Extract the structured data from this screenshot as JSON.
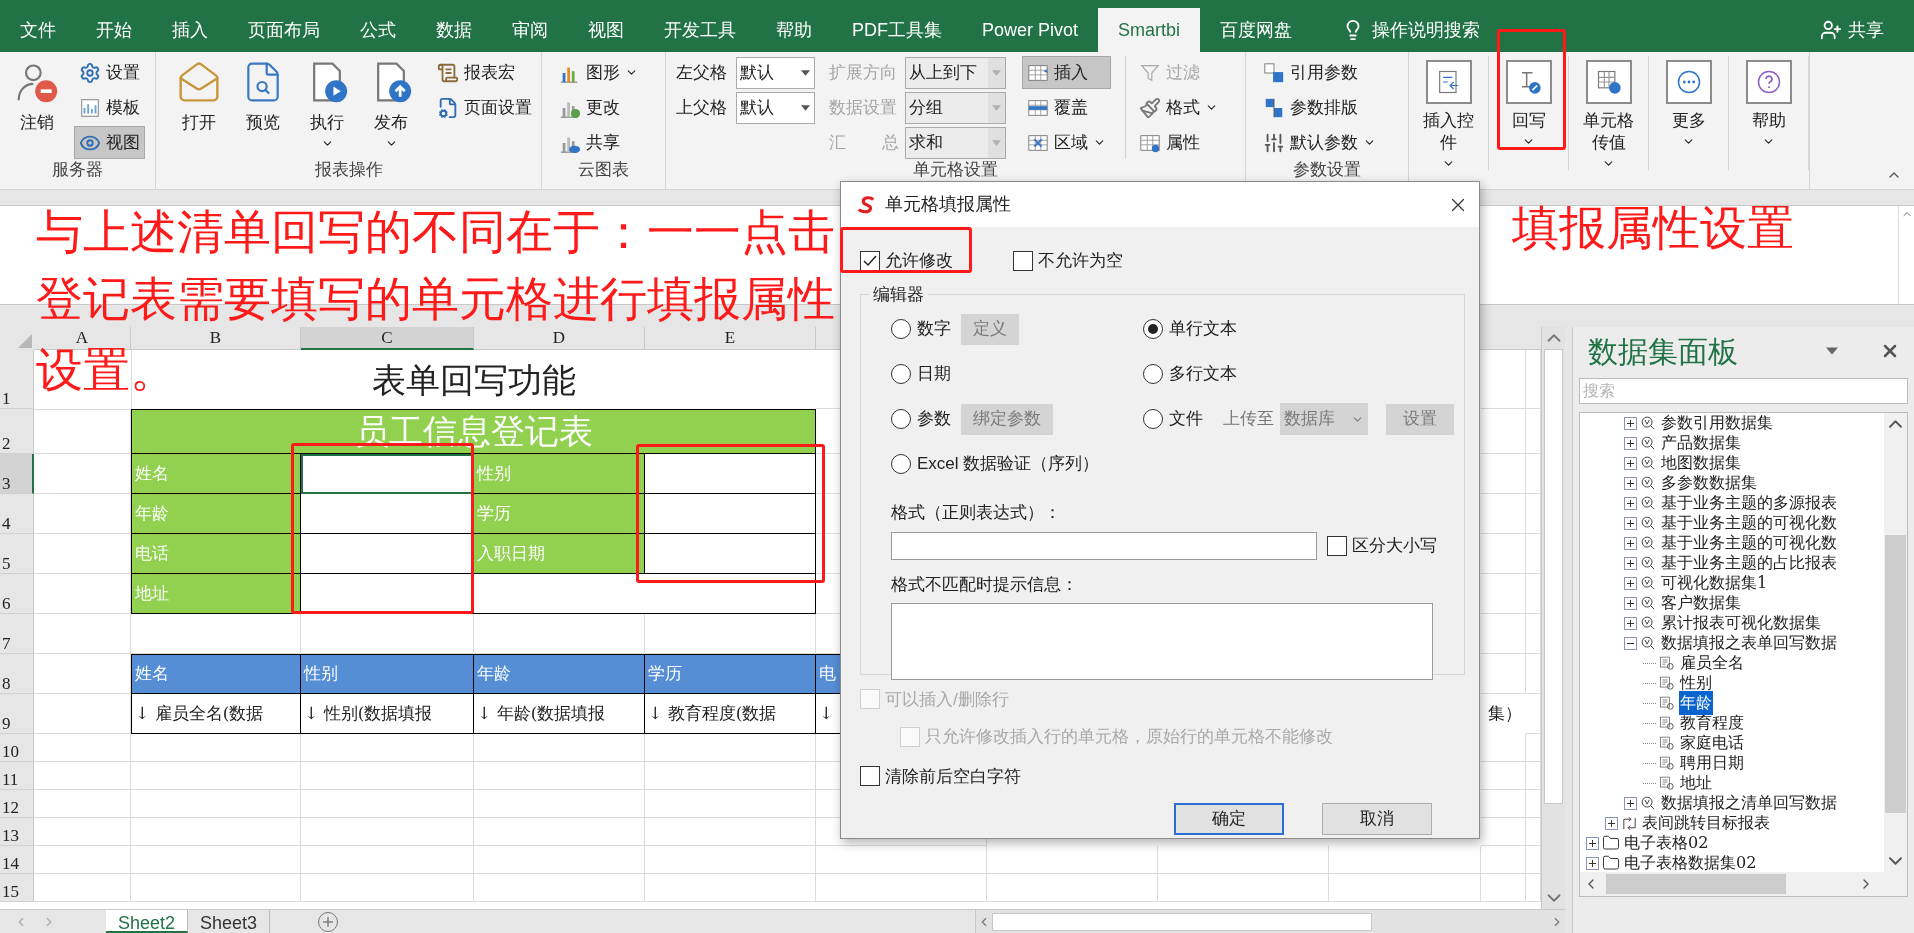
{
  "ribbon_tabs": [
    {
      "label": "文件",
      "selected": false
    },
    {
      "label": "开始",
      "selected": false
    },
    {
      "label": "插入",
      "selected": false
    },
    {
      "label": "页面布局",
      "selected": false
    },
    {
      "label": "公式",
      "selected": false
    },
    {
      "label": "数据",
      "selected": false
    },
    {
      "label": "审阅",
      "selected": false
    },
    {
      "label": "视图",
      "selected": false
    },
    {
      "label": "开发工具",
      "selected": false
    },
    {
      "label": "帮助",
      "selected": false
    },
    {
      "label": "PDF工具集",
      "selected": false
    },
    {
      "label": "Power Pivot",
      "selected": false
    },
    {
      "label": "Smartbi",
      "selected": true
    },
    {
      "label": "百度网盘",
      "selected": false
    }
  ],
  "tell_me": "操作说明搜索",
  "share": "共享",
  "ribbon_groups": [
    {
      "kind": "server",
      "label": "服务器",
      "big": [
        {
          "label": "注销",
          "dropdown": false
        }
      ],
      "small": [
        {
          "label": "设置",
          "pressed": false
        },
        {
          "label": "模板",
          "pressed": false
        },
        {
          "label": "视图",
          "pressed": true
        }
      ]
    },
    {
      "kind": "report",
      "label": "报表操作",
      "big": [
        {
          "label": "打开",
          "dropdown": false
        },
        {
          "label": "预览",
          "dropdown": false
        },
        {
          "label": "执行",
          "dropdown": true
        },
        {
          "label": "发布",
          "dropdown": true
        }
      ],
      "small": [
        {
          "label": "报表宏"
        },
        {
          "label": "页面设置"
        }
      ]
    },
    {
      "kind": "cloud",
      "label": "云图表",
      "small": [
        {
          "label": "图形",
          "dropdown": true
        },
        {
          "label": "更改",
          "dropdown": false
        },
        {
          "label": "共享",
          "dropdown": false
        }
      ]
    },
    {
      "kind": "cell",
      "label": "单元格设置",
      "selects": [
        {
          "label": "左父格",
          "value": "默认",
          "disabled": false
        },
        {
          "label": "上父格",
          "value": "默认",
          "disabled": false
        },
        {
          "label": "扩展方向",
          "value": "从上到下",
          "disabled": true
        },
        {
          "label": "数据设置",
          "value": "分组",
          "disabled": true
        },
        {
          "label": "汇 总",
          "value": "求和",
          "disabled": true
        }
      ],
      "small": [
        {
          "label": "插入",
          "pressed": true,
          "dropdown": false
        },
        {
          "label": "覆盖",
          "pressed": false,
          "dropdown": false
        },
        {
          "label": "区域",
          "pressed": false,
          "dropdown": true
        }
      ],
      "small_2": [
        {
          "label": "过滤",
          "disabled": true,
          "dropdown": false
        },
        {
          "label": "格式",
          "disabled": false,
          "dropdown": true
        },
        {
          "label": "属性",
          "disabled": false,
          "dropdown": false
        }
      ]
    },
    {
      "kind": "param",
      "label": "参数设置",
      "small": [
        {
          "label": "引用参数",
          "dropdown": false
        },
        {
          "label": "参数排版",
          "dropdown": false
        },
        {
          "label": "默认参数",
          "dropdown": true
        }
      ]
    },
    {
      "kind": "tools",
      "big": [
        {
          "label": "插入控件",
          "dropdown": true
        },
        {
          "label": "回写",
          "dropdown": true
        },
        {
          "label": "单元格传值",
          "dropdown": true
        },
        {
          "label": "更多",
          "dropdown": true
        },
        {
          "label": "帮助",
          "dropdown": true
        }
      ]
    }
  ],
  "annotation": {
    "lines": [
      "与上述清单回写的不同在于：一一点击",
      "登记表需要填写的单元格进行填报属性",
      "设置。"
    ],
    "callout": "填报属性设置"
  },
  "sheet": {
    "columns": [
      {
        "label": "A",
        "selected": false
      },
      {
        "label": "B",
        "selected": false
      },
      {
        "label": "C",
        "selected": true
      },
      {
        "label": "D",
        "selected": false
      },
      {
        "label": "E",
        "selected": false
      }
    ],
    "rows": [
      {
        "label": "1",
        "selected": false
      },
      {
        "label": "2",
        "selected": false
      },
      {
        "label": "3",
        "selected": true
      },
      {
        "label": "4",
        "selected": false
      },
      {
        "label": "5",
        "selected": false
      },
      {
        "label": "6",
        "selected": false
      },
      {
        "label": "7",
        "selected": false
      },
      {
        "label": "8",
        "selected": false
      },
      {
        "label": "9",
        "selected": false
      },
      {
        "label": "10",
        "selected": false
      },
      {
        "label": "11",
        "selected": false
      },
      {
        "label": "12",
        "selected": false
      },
      {
        "label": "13",
        "selected": false
      },
      {
        "label": "14",
        "selected": false
      },
      {
        "label": "15",
        "selected": false
      }
    ],
    "title": "表单回写功能",
    "form_title": "员工信息登记表",
    "form_rows": [
      {
        "label": "姓名",
        "label_2": "性别"
      },
      {
        "label": "年龄",
        "label_2": "学历"
      },
      {
        "label": "电话",
        "label_2": "入职日期"
      },
      {
        "label": "地址"
      }
    ],
    "list_headers": [
      "姓名",
      "性别",
      "年龄",
      "学历",
      "电"
    ],
    "list_cells": [
      "↓ 雇员全名(数据",
      "↓ 性别(数据填报",
      "↓ 年龄(数据填报",
      "↓ 教育程度(数据",
      "↓"
    ],
    "list_cell_tail": "集）"
  },
  "sheet_tabs": [
    {
      "label": "Sheet2",
      "selected": true
    },
    {
      "label": "Sheet3",
      "selected": false
    }
  ],
  "dialog": {
    "title": "单元格填报属性",
    "checks_top": [
      {
        "label": "允许修改",
        "checked": true
      },
      {
        "label": "不允许为空",
        "checked": false
      }
    ],
    "editor": {
      "legend": "编辑器",
      "options": [
        {
          "label": "数字",
          "selected": false,
          "button": {
            "label": "定义",
            "disabled": true
          }
        },
        {
          "label": "单行文本",
          "selected": true
        },
        {
          "label": "日期",
          "selected": false
        },
        {
          "label": "多行文本",
          "selected": false
        },
        {
          "label": "参数",
          "selected": false,
          "button": {
            "label": "绑定参数",
            "disabled": true
          }
        },
        {
          "label": "文件",
          "selected": false,
          "upload": {
            "label": "上传至",
            "value": "数据库",
            "disabled": true
          },
          "button": {
            "label": "设置",
            "disabled": true
          }
        },
        {
          "label": "Excel 数据验证（序列）",
          "selected": false
        }
      ],
      "format_label": "格式（正则表达式）：",
      "case_check": {
        "label": "区分大小写",
        "checked": false
      },
      "message_label": "格式不匹配时提示信息："
    },
    "row_checks": [
      {
        "label": "可以插入/删除行",
        "checked": false,
        "disabled": true,
        "children": [
          {
            "label": "只允许修改插入行的单元格，原始行的单元格不能修改",
            "checked": false,
            "disabled": true
          }
        ]
      },
      {
        "label": "清除前后空白字符",
        "checked": false,
        "disabled": false
      }
    ],
    "buttons": [
      {
        "label": "确定",
        "default": true
      },
      {
        "label": "取消",
        "default": false
      }
    ]
  },
  "dataset_panel": {
    "title": "数据集面板",
    "search_placeholder": "搜索",
    "tree": [
      {
        "children": [
          {
            "children": [
              {
                "label": "参数引用数据集",
                "kind": "dataset",
                "expanded": false,
                "selected": false
              },
              {
                "label": "产品数据集",
                "kind": "dataset",
                "expanded": false,
                "selected": false
              },
              {
                "label": "地图数据集",
                "kind": "dataset",
                "expanded": false,
                "selected": false
              },
              {
                "label": "多参数数据集",
                "kind": "dataset",
                "expanded": false,
                "selected": false
              },
              {
                "label": "基于业务主题的多源报表",
                "kind": "dataset",
                "expanded": false,
                "selected": false
              },
              {
                "label": "基于业务主题的可视化数",
                "kind": "dataset",
                "expanded": false,
                "selected": false
              },
              {
                "label": "基于业务主题的可视化数",
                "kind": "dataset",
                "expanded": false,
                "selected": false
              },
              {
                "label": "基于业务主题的占比报表",
                "kind": "dataset",
                "expanded": false,
                "selected": false
              },
              {
                "label": "可视化数据集1",
                "kind": "dataset",
                "expanded": false,
                "selected": false
              },
              {
                "label": "客户数据集",
                "kind": "dataset",
                "expanded": false,
                "selected": false
              },
              {
                "label": "累计报表可视化数据集",
                "kind": "dataset",
                "expanded": false,
                "selected": false
              },
              {
                "label": "数据填报之表单回写数据",
                "kind": "dataset",
                "expanded": true,
                "selected": false,
                "children": [
                  {
                    "label": "雇员全名",
                    "kind": "field",
                    "selected": false
                  },
                  {
                    "label": "性别",
                    "kind": "field",
                    "selected": false
                  },
                  {
                    "label": "年龄",
                    "kind": "field",
                    "selected": true
                  },
                  {
                    "label": "教育程度",
                    "kind": "field",
                    "selected": false
                  },
                  {
                    "label": "家庭电话",
                    "kind": "field",
                    "selected": false
                  },
                  {
                    "label": "聘用日期",
                    "kind": "field",
                    "selected": false
                  },
                  {
                    "label": "地址",
                    "kind": "field",
                    "selected": false
                  }
                ]
              },
              {
                "label": "数据填报之清单回写数据",
                "kind": "dataset",
                "expanded": false,
                "selected": false
              }
            ]
          },
          {
            "label": "表间跳转目标报表",
            "kind": "jump",
            "expanded": false,
            "selected": false
          }
        ]
      },
      {
        "label": "电子表格02",
        "kind": "folder",
        "expanded": false,
        "selected": false
      },
      {
        "label": "电子表格数据集02",
        "kind": "folder",
        "expanded": false,
        "selected": false
      }
    ]
  }
}
